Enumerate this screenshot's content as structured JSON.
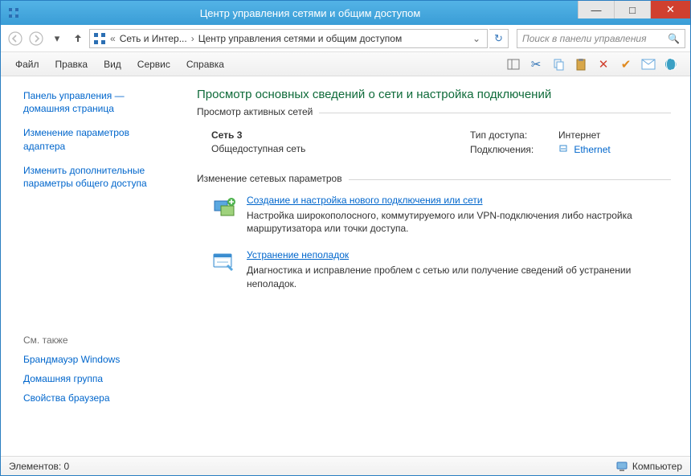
{
  "window": {
    "title": "Центр управления сетями и общим доступом"
  },
  "breadcrumb": {
    "seg1": "Сеть и Интер...",
    "seg2": "Центр управления сетями и общим доступом"
  },
  "search": {
    "placeholder": "Поиск в панели управления"
  },
  "menu": {
    "file": "Файл",
    "edit": "Правка",
    "view": "Вид",
    "service": "Сервис",
    "help": "Справка"
  },
  "sidebar": {
    "home": "Панель управления — домашняя страница",
    "adapter": "Изменение параметров адаптера",
    "sharing": "Изменить дополнительные параметры общего доступа",
    "seealso_header": "См. также",
    "seealso": {
      "firewall": "Брандмауэр Windows",
      "homegroup": "Домашняя группа",
      "browser": "Свойства браузера"
    }
  },
  "main": {
    "heading": "Просмотр основных сведений о сети и настройка подключений",
    "active_legend": "Просмотр активных сетей",
    "network": {
      "name": "Сеть  3",
      "category": "Общедоступная сеть",
      "access_label": "Тип доступа:",
      "access_value": "Интернет",
      "conn_label": "Подключения:",
      "conn_value": "Ethernet"
    },
    "settings_legend": "Изменение сетевых параметров",
    "task1": {
      "title": "Создание и настройка нового подключения или сети",
      "desc": "Настройка широкополосного, коммутируемого или VPN-подключения либо настройка маршрутизатора или точки доступа."
    },
    "task2": {
      "title": "Устранение неполадок",
      "desc": "Диагностика и исправление проблем с сетью или получение сведений об устранении неполадок."
    }
  },
  "statusbar": {
    "items": "Элементов: 0",
    "computer": "Компьютер"
  }
}
